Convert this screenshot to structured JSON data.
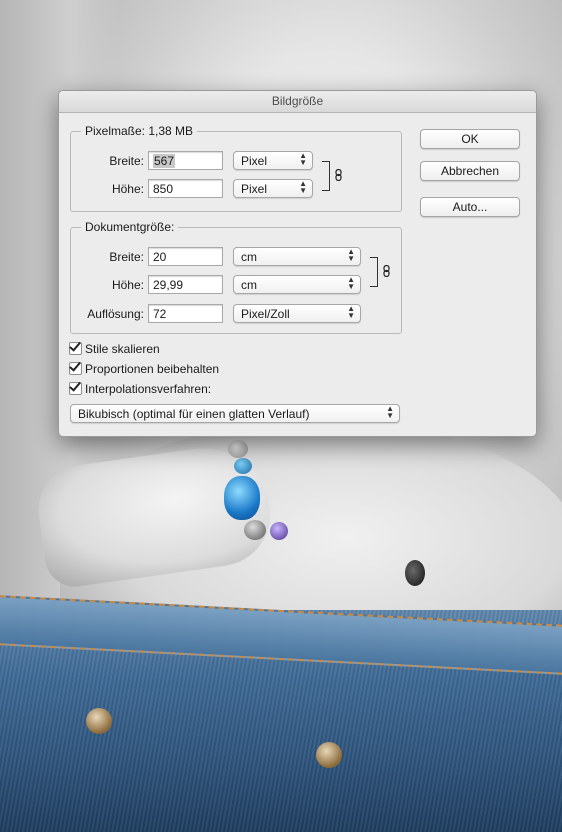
{
  "dialog": {
    "title": "Bildgröße",
    "pixel_dimensions": {
      "legend": "Pixelmaße: 1,38 MB",
      "width_label": "Breite:",
      "width_value": "567",
      "width_unit": "Pixel",
      "height_label": "Höhe:",
      "height_value": "850",
      "height_unit": "Pixel"
    },
    "document_size": {
      "legend": "Dokumentgröße:",
      "width_label": "Breite:",
      "width_value": "20",
      "width_unit": "cm",
      "height_label": "Höhe:",
      "height_value": "29,99",
      "height_unit": "cm",
      "resolution_label": "Auflösung:",
      "resolution_value": "72",
      "resolution_unit": "Pixel/Zoll"
    },
    "buttons": {
      "ok": "OK",
      "cancel": "Abbrechen",
      "auto": "Auto..."
    },
    "options": {
      "scale_styles": "Stile skalieren",
      "constrain_proportions": "Proportionen beibehalten",
      "resample": "Interpolationsverfahren:",
      "resample_method": "Bikubisch (optimal für einen glatten Verlauf)"
    }
  }
}
